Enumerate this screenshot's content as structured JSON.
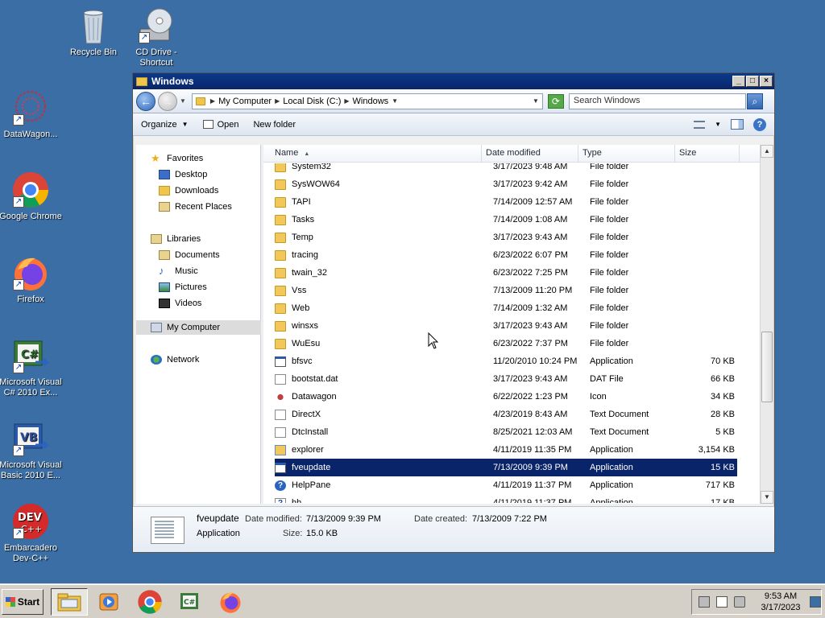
{
  "desktop": {
    "icons": [
      {
        "label": "Recycle Bin",
        "icon": "recycle-bin-icon"
      },
      {
        "label": "CD Drive - Shortcut",
        "icon": "cd-drive-icon"
      },
      {
        "label": "DataWagon...",
        "icon": "datawagon-icon"
      },
      {
        "label": "Google Chrome",
        "icon": "chrome-icon"
      },
      {
        "label": "Firefox",
        "icon": "firefox-icon"
      },
      {
        "label": "Microsoft Visual C# 2010 Ex...",
        "icon": "visual-csharp-icon"
      },
      {
        "label": "Microsoft Visual Basic 2010 E...",
        "icon": "visual-basic-icon"
      },
      {
        "label": "Embarcadero Dev-C++",
        "icon": "devcpp-icon"
      }
    ]
  },
  "window": {
    "title": "Windows",
    "address": {
      "crumbs": [
        "My Computer",
        "Local Disk (C:)",
        "Windows"
      ]
    },
    "search": {
      "placeholder": "Search Windows"
    },
    "toolbar": {
      "organize": "Organize",
      "open": "Open",
      "new_folder": "New folder"
    },
    "nav": {
      "favorites": "Favorites",
      "desktop": "Desktop",
      "downloads": "Downloads",
      "recent": "Recent Places",
      "libraries": "Libraries",
      "documents": "Documents",
      "music": "Music",
      "pictures": "Pictures",
      "videos": "Videos",
      "my_computer": "My Computer",
      "network": "Network"
    },
    "columns": {
      "name": "Name",
      "date": "Date modified",
      "type": "Type",
      "size": "Size"
    },
    "files": [
      {
        "name": "System32",
        "date": "3/17/2023 9:48 AM",
        "type": "File folder",
        "size": "",
        "kind": "folder"
      },
      {
        "name": "SysWOW64",
        "date": "3/17/2023 9:42 AM",
        "type": "File folder",
        "size": "",
        "kind": "folder"
      },
      {
        "name": "TAPI",
        "date": "7/14/2009 12:57 AM",
        "type": "File folder",
        "size": "",
        "kind": "folder"
      },
      {
        "name": "Tasks",
        "date": "7/14/2009 1:08 AM",
        "type": "File folder",
        "size": "",
        "kind": "folder"
      },
      {
        "name": "Temp",
        "date": "3/17/2023 9:43 AM",
        "type": "File folder",
        "size": "",
        "kind": "folder"
      },
      {
        "name": "tracing",
        "date": "6/23/2022 6:07 PM",
        "type": "File folder",
        "size": "",
        "kind": "folder"
      },
      {
        "name": "twain_32",
        "date": "6/23/2022 7:25 PM",
        "type": "File folder",
        "size": "",
        "kind": "folder"
      },
      {
        "name": "Vss",
        "date": "7/13/2009 11:20 PM",
        "type": "File folder",
        "size": "",
        "kind": "folder"
      },
      {
        "name": "Web",
        "date": "7/14/2009 1:32 AM",
        "type": "File folder",
        "size": "",
        "kind": "folder"
      },
      {
        "name": "winsxs",
        "date": "3/17/2023 9:43 AM",
        "type": "File folder",
        "size": "",
        "kind": "folder"
      },
      {
        "name": "WuEsu",
        "date": "6/23/2022 7:37 PM",
        "type": "File folder",
        "size": "",
        "kind": "folder"
      },
      {
        "name": "bfsvc",
        "date": "11/20/2010 10:24 PM",
        "type": "Application",
        "size": "70 KB",
        "kind": "app"
      },
      {
        "name": "bootstat.dat",
        "date": "3/17/2023 9:43 AM",
        "type": "DAT File",
        "size": "66 KB",
        "kind": "doc"
      },
      {
        "name": "Datawagon",
        "date": "6/22/2022 1:23 PM",
        "type": "Icon",
        "size": "34 KB",
        "kind": "icon"
      },
      {
        "name": "DirectX",
        "date": "4/23/2019 8:43 AM",
        "type": "Text Document",
        "size": "28 KB",
        "kind": "doc"
      },
      {
        "name": "DtcInstall",
        "date": "8/25/2021 12:03 AM",
        "type": "Text Document",
        "size": "5 KB",
        "kind": "doc"
      },
      {
        "name": "explorer",
        "date": "4/11/2019 11:35 PM",
        "type": "Application",
        "size": "3,154 KB",
        "kind": "explorer"
      },
      {
        "name": "fveupdate",
        "date": "7/13/2009 9:39 PM",
        "type": "Application",
        "size": "15 KB",
        "kind": "app",
        "selected": true
      },
      {
        "name": "HelpPane",
        "date": "4/11/2019 11:37 PM",
        "type": "Application",
        "size": "717 KB",
        "kind": "help"
      },
      {
        "name": "hh",
        "date": "4/11/2019 11:37 PM",
        "type": "Application",
        "size": "17 KB",
        "kind": "hh"
      }
    ],
    "details": {
      "name": "fveupdate",
      "kind": "Application",
      "date_modified_label": "Date modified:",
      "date_modified": "7/13/2009 9:39 PM",
      "date_created_label": "Date created:",
      "date_created": "7/13/2009 7:22 PM",
      "size_label": "Size:",
      "size": "15.0 KB"
    }
  },
  "taskbar": {
    "start": "Start",
    "time": "9:53 AM",
    "date": "3/17/2023"
  }
}
